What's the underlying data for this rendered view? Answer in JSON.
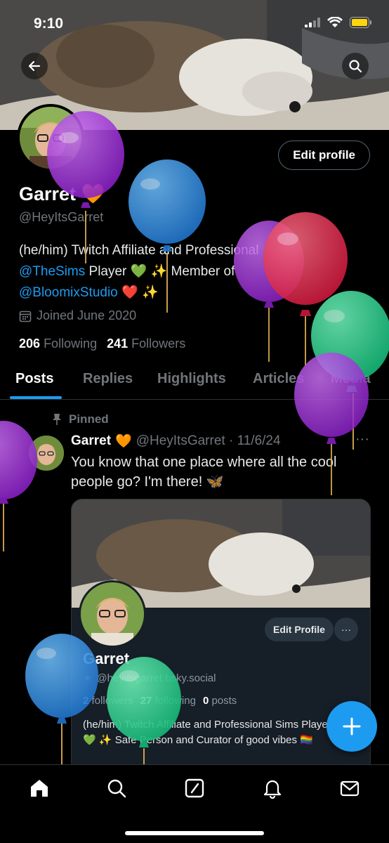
{
  "status_bar": {
    "time": "9:10"
  },
  "profile": {
    "name": "Garret",
    "name_emoji": "🧡",
    "handle": "@HeyItsGarret",
    "edit_label": "Edit profile",
    "bio_prefix": "(he/him) Twitch Affiliate and Professional",
    "bio_link_1": "@TheSims",
    "bio_mid": " Player 💚 ✨ Member of",
    "bio_link_2": "@BloomixStudio",
    "bio_suffix": " ❤️ ✨",
    "joined": "Joined June 2020",
    "following_count": "206",
    "following_label": "Following",
    "followers_count": "241",
    "followers_label": "Followers"
  },
  "tabs": [
    "Posts",
    "Replies",
    "Highlights",
    "Articles",
    "Media"
  ],
  "post": {
    "pinned_label": "Pinned",
    "author": "Garret",
    "author_emoji": "🧡",
    "handle_date": "@HeyItsGarret · 11/6/24",
    "more": "···",
    "text": "You know that one place where all the cool people go? I'm there! 🦋"
  },
  "embed": {
    "edit_label": "Edit Profile",
    "more": "···",
    "name": "Garret",
    "handle": "@heyitsgarret.bsky.social",
    "followers_count": "2",
    "followers_label": "followers",
    "following_count": "27",
    "following_label": "following",
    "posts_count": "0",
    "posts_label": "posts",
    "bio_line1": "(he/him) Twitch Affiliate and Professional Sims Player",
    "bio_line2": "💚 ✨ Safe Person and Curator of good vibes 🏳️‍🌈"
  },
  "colors": {
    "accent": "#1d9bf0",
    "balloon_purple": "#9b2fd6",
    "balloon_blue": "#2f8ee0",
    "balloon_red": "#e8304f",
    "balloon_green": "#2ed68f"
  },
  "icons": {
    "back": "back-arrow-icon",
    "search": "search-icon",
    "calendar": "calendar-icon",
    "pin": "pin-icon",
    "compose": "plus-icon",
    "nav": [
      "home-icon",
      "search-icon",
      "grok-icon",
      "bell-icon",
      "mail-icon"
    ]
  }
}
